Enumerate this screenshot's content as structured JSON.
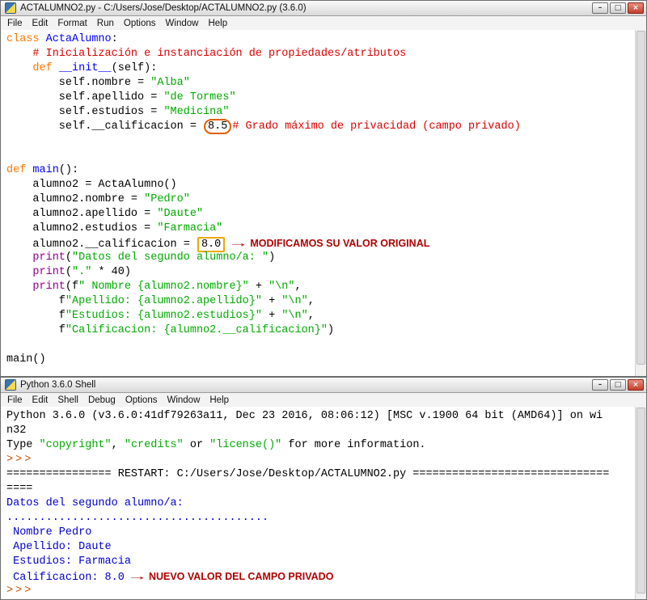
{
  "colors": {
    "keyword": "#ff7700",
    "defname": "#0000ff",
    "string": "#00aa00",
    "comment": "#dd0000",
    "builtin": "#900090",
    "output": "#0000cd",
    "prompt": "#c75000",
    "annotation": "#b20000",
    "circle_highlight": "#e06000",
    "box_highlight": "#eda800"
  },
  "chrome": {
    "minimize": "–",
    "maximize": "□",
    "close": "×"
  },
  "editor": {
    "title": "ACTALUMNO2.py - C:/Users/Jose/Desktop/ACTALUMNO2.py (3.6.0)",
    "menu": [
      "File",
      "Edit",
      "Format",
      "Run",
      "Options",
      "Window",
      "Help"
    ],
    "lines": [
      [
        {
          "c": "kw",
          "t": "class"
        },
        {
          "c": "pl",
          "t": " "
        },
        {
          "c": "name",
          "t": "ActaAlumno"
        },
        {
          "c": "pl",
          "t": ":"
        }
      ],
      [
        {
          "c": "pl",
          "t": "    "
        },
        {
          "c": "com",
          "t": "# Inicialización e instanciación de propiedades/atributos"
        }
      ],
      [
        {
          "c": "pl",
          "t": "    "
        },
        {
          "c": "kw",
          "t": "def"
        },
        {
          "c": "pl",
          "t": " "
        },
        {
          "c": "name",
          "t": "__init__"
        },
        {
          "c": "pl",
          "t": "(self):"
        }
      ],
      [
        {
          "c": "pl",
          "t": "        self.nombre = "
        },
        {
          "c": "str",
          "t": "\"Alba\""
        }
      ],
      [
        {
          "c": "pl",
          "t": "        self.apellido = "
        },
        {
          "c": "str",
          "t": "\"de Tormes\""
        }
      ],
      [
        {
          "c": "pl",
          "t": "        self.estudios = "
        },
        {
          "c": "str",
          "t": "\"Medicina\""
        }
      ],
      [
        {
          "c": "pl",
          "t": "        self.__calificacion = "
        },
        {
          "c": "box1",
          "t": "8.5"
        },
        {
          "c": "com",
          "t": "# Grado máximo de privacidad (campo privado)"
        }
      ],
      [],
      [],
      [
        {
          "c": "kw",
          "t": "def"
        },
        {
          "c": "pl",
          "t": " "
        },
        {
          "c": "name",
          "t": "main"
        },
        {
          "c": "pl",
          "t": "():"
        }
      ],
      [
        {
          "c": "pl",
          "t": "    alumno2 = ActaAlumno()"
        }
      ],
      [
        {
          "c": "pl",
          "t": "    alumno2.nombre = "
        },
        {
          "c": "str",
          "t": "\"Pedro\""
        }
      ],
      [
        {
          "c": "pl",
          "t": "    alumno2.apellido = "
        },
        {
          "c": "str",
          "t": "\"Daute\""
        }
      ],
      [
        {
          "c": "pl",
          "t": "    alumno2.estudios = "
        },
        {
          "c": "str",
          "t": "\"Farmacia\""
        }
      ],
      [
        {
          "c": "pl",
          "t": "    alumno2.__calificacion = "
        },
        {
          "c": "box2",
          "t": "8.0"
        },
        {
          "c": "arrow",
          "t": "→"
        },
        {
          "c": "note",
          "t": "MODIFICAMOS SU VALOR ORIGINAL"
        }
      ],
      [
        {
          "c": "pl",
          "t": "    "
        },
        {
          "c": "blt",
          "t": "print"
        },
        {
          "c": "pl",
          "t": "("
        },
        {
          "c": "str",
          "t": "\"Datos del segundo alumno/a: \""
        },
        {
          "c": "pl",
          "t": ")"
        }
      ],
      [
        {
          "c": "pl",
          "t": "    "
        },
        {
          "c": "blt",
          "t": "print"
        },
        {
          "c": "pl",
          "t": "("
        },
        {
          "c": "str",
          "t": "\".\""
        },
        {
          "c": "pl",
          "t": " * 40)"
        }
      ],
      [
        {
          "c": "pl",
          "t": "    "
        },
        {
          "c": "blt",
          "t": "print"
        },
        {
          "c": "pl",
          "t": "(f"
        },
        {
          "c": "str",
          "t": "\" Nombre {alumno2.nombre}\""
        },
        {
          "c": "pl",
          "t": " + "
        },
        {
          "c": "str",
          "t": "\"\\n\""
        },
        {
          "c": "pl",
          "t": ","
        }
      ],
      [
        {
          "c": "pl",
          "t": "        f"
        },
        {
          "c": "str",
          "t": "\"Apellido: {alumno2.apellido}\""
        },
        {
          "c": "pl",
          "t": " + "
        },
        {
          "c": "str",
          "t": "\"\\n\""
        },
        {
          "c": "pl",
          "t": ","
        }
      ],
      [
        {
          "c": "pl",
          "t": "        f"
        },
        {
          "c": "str",
          "t": "\"Estudios: {alumno2.estudios}\""
        },
        {
          "c": "pl",
          "t": " + "
        },
        {
          "c": "str",
          "t": "\"\\n\""
        },
        {
          "c": "pl",
          "t": ","
        }
      ],
      [
        {
          "c": "pl",
          "t": "        f"
        },
        {
          "c": "str",
          "t": "\"Calificacion: {alumno2.__calificacion}\""
        },
        {
          "c": "pl",
          "t": ")"
        }
      ],
      [],
      [
        {
          "c": "pl",
          "t": "main()"
        }
      ]
    ]
  },
  "shell": {
    "title": "Python 3.6.0 Shell",
    "menu": [
      "File",
      "Edit",
      "Shell",
      "Debug",
      "Options",
      "Window",
      "Help"
    ],
    "lines": [
      [
        {
          "c": "pl",
          "t": "Python 3.6.0 (v3.6.0:41df79263a11, Dec 23 2016, 08:06:12) [MSC v.1900 64 bit (AMD64)] on wi"
        }
      ],
      [
        {
          "c": "pl",
          "t": "n32"
        }
      ],
      [
        {
          "c": "pl",
          "t": "Type "
        },
        {
          "c": "str",
          "t": "\"copyright\""
        },
        {
          "c": "pl",
          "t": ", "
        },
        {
          "c": "str",
          "t": "\"credits\""
        },
        {
          "c": "pl",
          "t": " or "
        },
        {
          "c": "str",
          "t": "\"license()\""
        },
        {
          "c": "pl",
          "t": " for more information."
        }
      ],
      [
        {
          "c": "prm",
          "t": ">>> "
        }
      ],
      [
        {
          "c": "pl",
          "t": "================ RESTART: C:/Users/Jose/Desktop/ACTALUMNO2.py =============================="
        }
      ],
      [
        {
          "c": "pl",
          "t": "===="
        }
      ],
      [
        {
          "c": "out",
          "t": "Datos del segundo alumno/a: "
        }
      ],
      [
        {
          "c": "out",
          "t": "........................................"
        }
      ],
      [
        {
          "c": "out",
          "t": " Nombre Pedro"
        }
      ],
      [
        {
          "c": "out",
          "t": " Apellido: Daute"
        }
      ],
      [
        {
          "c": "out",
          "t": " Estudios: Farmacia"
        }
      ],
      [
        {
          "c": "out",
          "t": " Calificacion: 8.0"
        },
        {
          "c": "arrow",
          "t": "→"
        },
        {
          "c": "note",
          "t": "NUEVO VALOR DEL CAMPO PRIVADO"
        }
      ],
      [
        {
          "c": "prm",
          "t": ">>> "
        }
      ]
    ]
  }
}
